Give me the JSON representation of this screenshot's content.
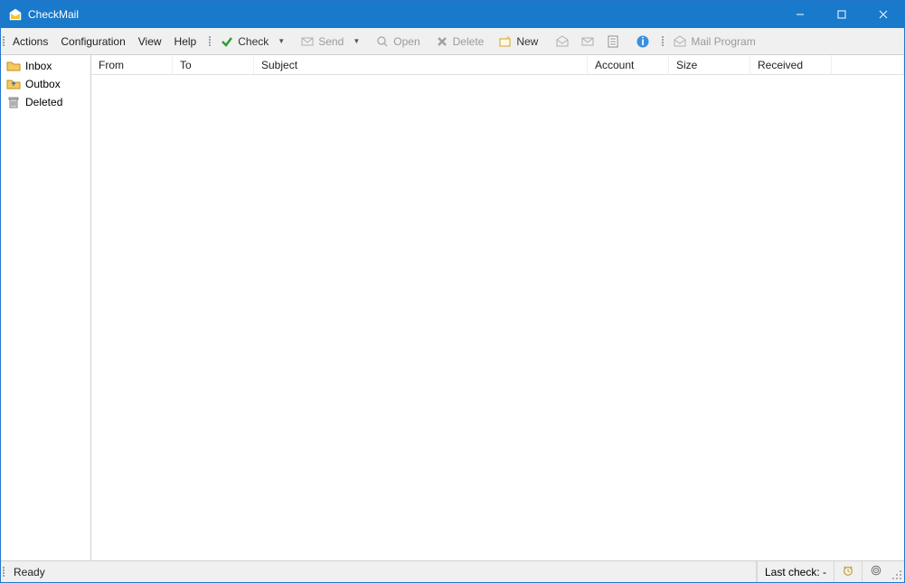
{
  "app": {
    "title": "CheckMail"
  },
  "menu": {
    "items": [
      "Actions",
      "Configuration",
      "View",
      "Help"
    ]
  },
  "toolbar": {
    "check": "Check",
    "send": "Send",
    "open": "Open",
    "delete": "Delete",
    "new": "New",
    "mail_program": "Mail Program"
  },
  "sidebar": {
    "folders": [
      {
        "label": "Inbox"
      },
      {
        "label": "Outbox"
      },
      {
        "label": "Deleted"
      }
    ]
  },
  "columns": {
    "from": "From",
    "to": "To",
    "subject": "Subject",
    "account": "Account",
    "size": "Size",
    "received": "Received"
  },
  "status": {
    "ready": "Ready",
    "last_check": "Last check: -"
  },
  "colors": {
    "titlebar": "#1979ca",
    "accent": "#2f9e2f"
  }
}
